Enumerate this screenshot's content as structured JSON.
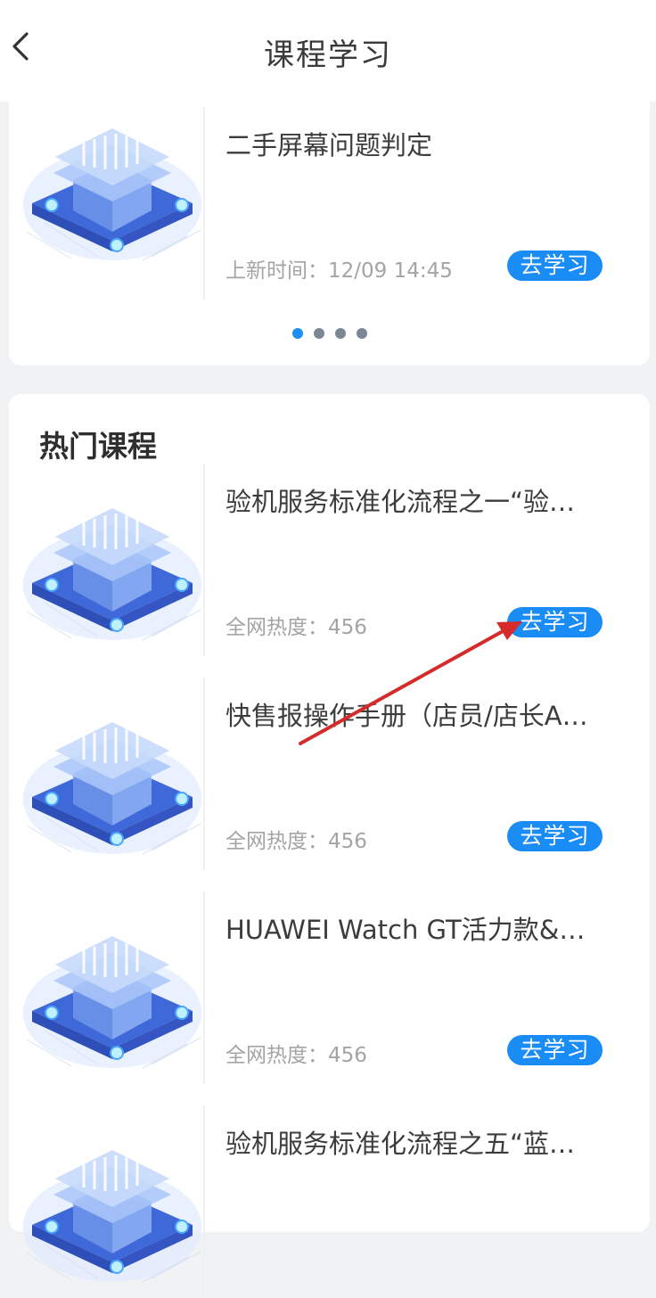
{
  "header": {
    "title": "课程学习",
    "back_icon": "chevron-left-icon"
  },
  "featured": {
    "title": "二手屏幕问题判定",
    "meta": "上新时间：12/09 14:45",
    "button": "去学习",
    "carousel_pages": 4,
    "carousel_active": 1
  },
  "hot": {
    "heading": "热门课程",
    "items": [
      {
        "title": "验机服务标准化流程之一“验…",
        "meta": "全网热度：456",
        "button": "去学习"
      },
      {
        "title": "快售报操作手册（店员/店长A…",
        "meta": "全网热度：456",
        "button": "去学习"
      },
      {
        "title": "HUAWEI Watch GT活力款&…",
        "meta": "全网热度：456",
        "button": "去学习"
      },
      {
        "title": "验机服务标准化流程之五“蓝…",
        "meta": "",
        "button": ""
      }
    ]
  },
  "colors": {
    "accent": "#1a8cf5",
    "annotation_arrow": "#d62b2b"
  }
}
